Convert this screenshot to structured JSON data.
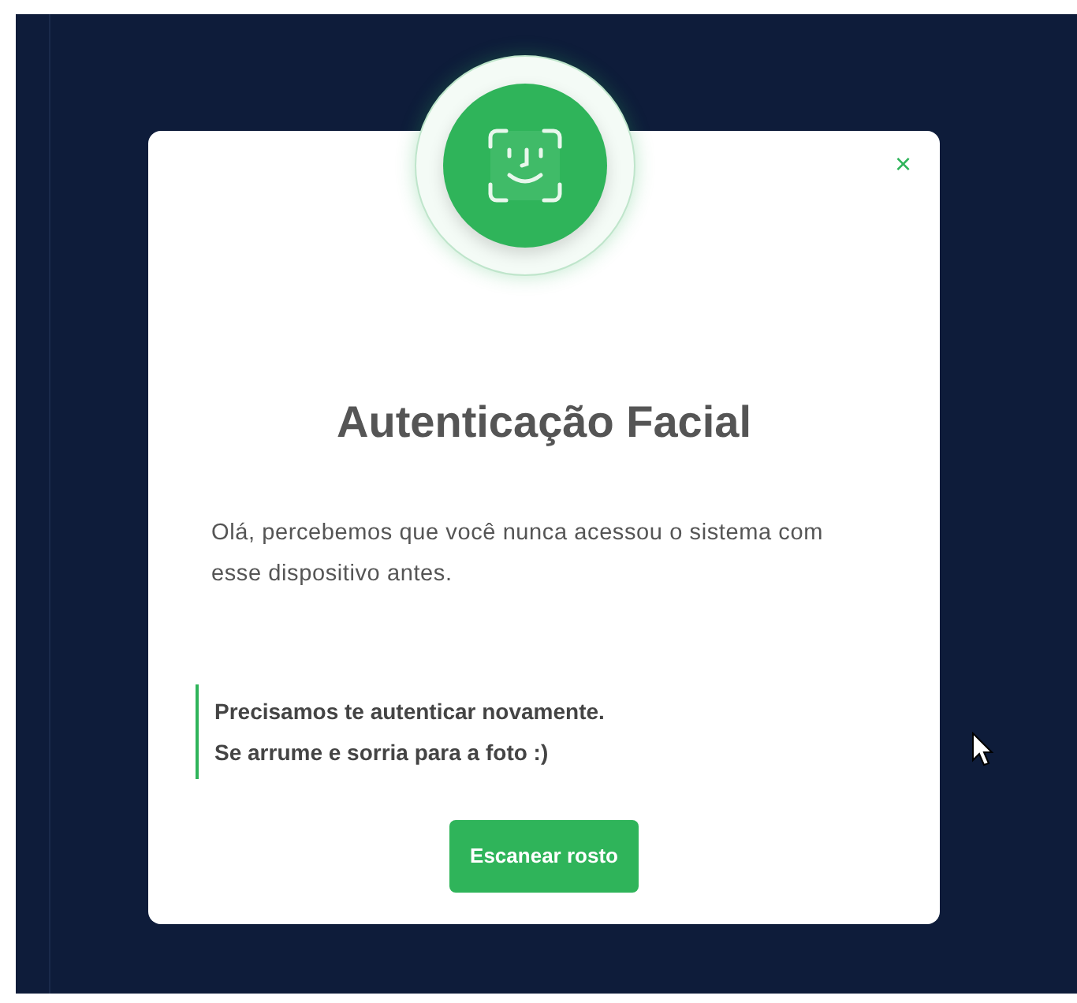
{
  "dialog": {
    "title": "Autenticação Facial",
    "message": "Olá, percebemos que você nunca acessou o sistema com esse dispositivo antes.",
    "notice": [
      "Precisamos te autenticar novamente.",
      "Se arrume e sorria para a foto :)"
    ],
    "close": "×",
    "button": "Escanear rosto"
  }
}
